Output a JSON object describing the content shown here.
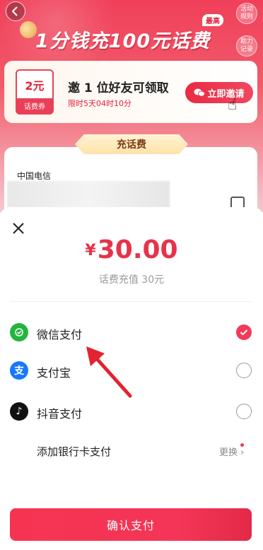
{
  "promo": {
    "headline": "1分钱充100元话费",
    "best_tag": "最高",
    "side_buttons": [
      "活动规则",
      "助力记录"
    ],
    "coupon_value": "2元",
    "coupon_label": "话费券",
    "invite_title": "邀 1 位好友可领取",
    "invite_subtitle": "限时5天04时10分",
    "invite_button": "立即邀请",
    "recharge_banner": "充话费",
    "carrier": "中国电信"
  },
  "payment": {
    "currency": "¥",
    "amount": "30.00",
    "description": "话费充值 30元",
    "methods": [
      {
        "label": "微信支付",
        "icon": "wechat-pay-icon",
        "color": "#23b53c",
        "selected": true
      },
      {
        "label": "支付宝",
        "icon": "alipay-icon",
        "color": "#1677ff",
        "selected": false
      },
      {
        "label": "抖音支付",
        "icon": "douyin-pay-icon",
        "color": "#111111",
        "selected": false
      }
    ],
    "bank_card": {
      "label": "添加银行卡支付",
      "action": "更换"
    },
    "confirm_button": "确认支付"
  },
  "colors": {
    "accent": "#f23a57",
    "price": "#e8324a"
  }
}
